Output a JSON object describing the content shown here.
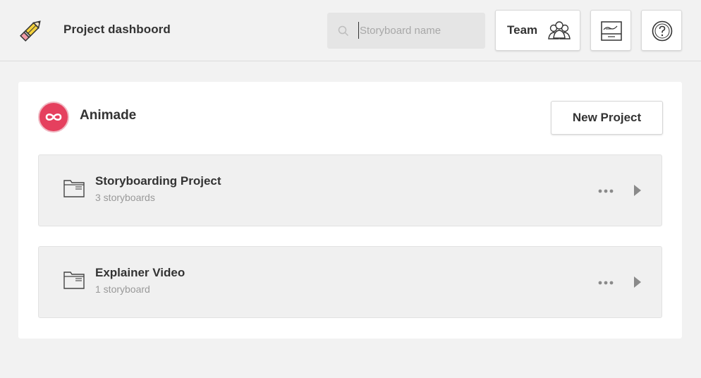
{
  "header": {
    "title": "Project dashboord",
    "logo_icon": "pencil-icon",
    "search": {
      "placeholder": "Storyboard name",
      "value": ""
    },
    "team_button": {
      "label": "Team",
      "icon": "team-icon"
    },
    "storyboard_button": {
      "icon": "storyboard-icon"
    },
    "help_button": {
      "icon": "help-icon"
    }
  },
  "team": {
    "name": "Animade",
    "avatar_color": "#e5405e",
    "avatar_icon": "infinity-icon"
  },
  "new_project_label": "New Project",
  "projects": [
    {
      "name": "Storyboarding Project",
      "count": "3 storyboards"
    },
    {
      "name": "Explainer Video",
      "count": "1 storyboard"
    }
  ]
}
